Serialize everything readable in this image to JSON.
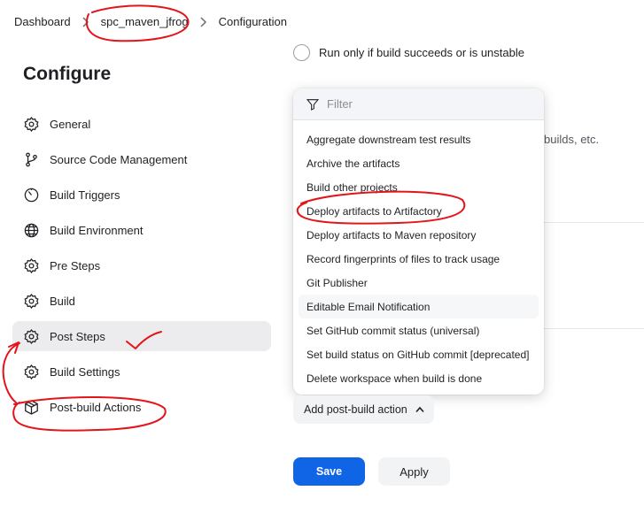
{
  "breadcrumb": {
    "items": [
      "Dashboard",
      "spc_maven_jfrog",
      "Configuration"
    ]
  },
  "page": {
    "title": "Configure"
  },
  "sidebar": {
    "items": [
      {
        "label": "General",
        "icon": "gear-icon"
      },
      {
        "label": "Source Code Management",
        "icon": "branch-icon"
      },
      {
        "label": "Build Triggers",
        "icon": "timer-icon"
      },
      {
        "label": "Build Environment",
        "icon": "globe-icon"
      },
      {
        "label": "Pre Steps",
        "icon": "gear-icon"
      },
      {
        "label": "Build",
        "icon": "gear-icon"
      },
      {
        "label": "Post Steps",
        "icon": "gear-icon",
        "active": true
      },
      {
        "label": "Build Settings",
        "icon": "gear-icon"
      },
      {
        "label": "Post-build Actions",
        "icon": "package-icon"
      }
    ]
  },
  "content": {
    "run_only_label": "Run only if build succeeds or is unstable",
    "peek_text": "builds, etc."
  },
  "dropdown": {
    "filter_placeholder": "Filter",
    "options": [
      "Aggregate downstream test results",
      "Archive the artifacts",
      "Build other projects",
      "Deploy artifacts to Artifactory",
      "Deploy artifacts to Maven repository",
      "Record fingerprints of files to track usage",
      "Git Publisher",
      "Editable Email Notification",
      "Set GitHub commit status (universal)",
      "Set build status on GitHub commit [deprecated]",
      "Delete workspace when build is done"
    ]
  },
  "actions": {
    "add_post_build_label": "Add post-build action",
    "save_label": "Save",
    "apply_label": "Apply"
  },
  "colors": {
    "primary": "#1064e6",
    "annotation": "#e3141a",
    "active_bg": "#ececef"
  }
}
